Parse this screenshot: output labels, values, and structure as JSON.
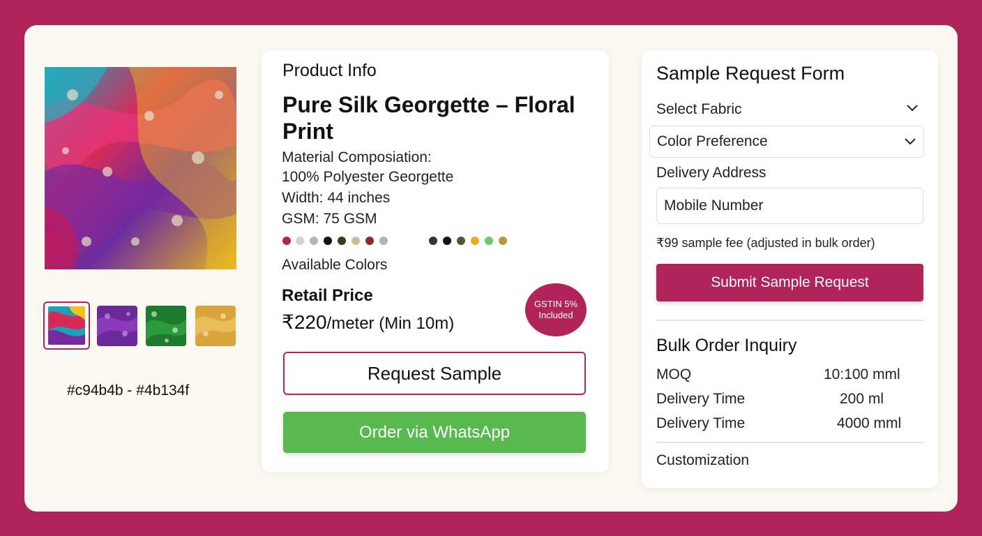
{
  "colors": {
    "brand": "#b0245a",
    "whatsapp": "#57b94e",
    "background": "#b0245a",
    "panel": "#faf8f1"
  },
  "gallery": {
    "hex_caption": "#c94b4b - #4b134f",
    "thumbnails": [
      {
        "name": "multicolor",
        "selected": true
      },
      {
        "name": "purple",
        "selected": false
      },
      {
        "name": "green",
        "selected": false
      },
      {
        "name": "mustard",
        "selected": false
      }
    ]
  },
  "product": {
    "section_heading": "Product Info",
    "title": "Pure Silk Georgette – Floral Print",
    "material_label": "Material Composiation:",
    "material_value": "100% Polyester Georgette",
    "width": "Width: 44 inches",
    "gsm": "GSM: 75 GSM",
    "swatches": [
      "#b0245a",
      "#d2d2d2",
      "#b5b5b5",
      "#111111",
      "#3b3a1c",
      "#c9c09a",
      "#8a2a33",
      "#b9b1b1",
      "#333338",
      "#111111",
      "#4a5a2c",
      "#e9ad1a",
      "#6acb6a",
      "#b09a3c"
    ],
    "available_colors_label": "Available Colors",
    "retail_price_label": "Retail Price",
    "price": "₹220",
    "price_unit": "/meter (Min 10m)",
    "gst_badge_line1": "GSTIN 5%",
    "gst_badge_line2": "Included",
    "request_sample_label": "Request Sample",
    "whatsapp_label": "Order via WhatsApp"
  },
  "sample_form": {
    "title": "Sample Request Form",
    "select_fabric": "Select Fabric",
    "color_preference": "Color Preference",
    "delivery_address": "Delivery Address",
    "mobile_number": "Mobile Number",
    "fee_note": "₹99 sample fee (adjusted in bulk order)",
    "submit_label": "Submit Sample Request"
  },
  "bulk": {
    "title": "Bulk Order Inquiry",
    "rows": [
      {
        "label": "MOQ",
        "value": "10:100 mml"
      },
      {
        "label": "Delivery Time",
        "value": "200 ml"
      },
      {
        "label": "Delivery Time",
        "value": "4000 mml"
      }
    ],
    "customization": "Customization"
  }
}
